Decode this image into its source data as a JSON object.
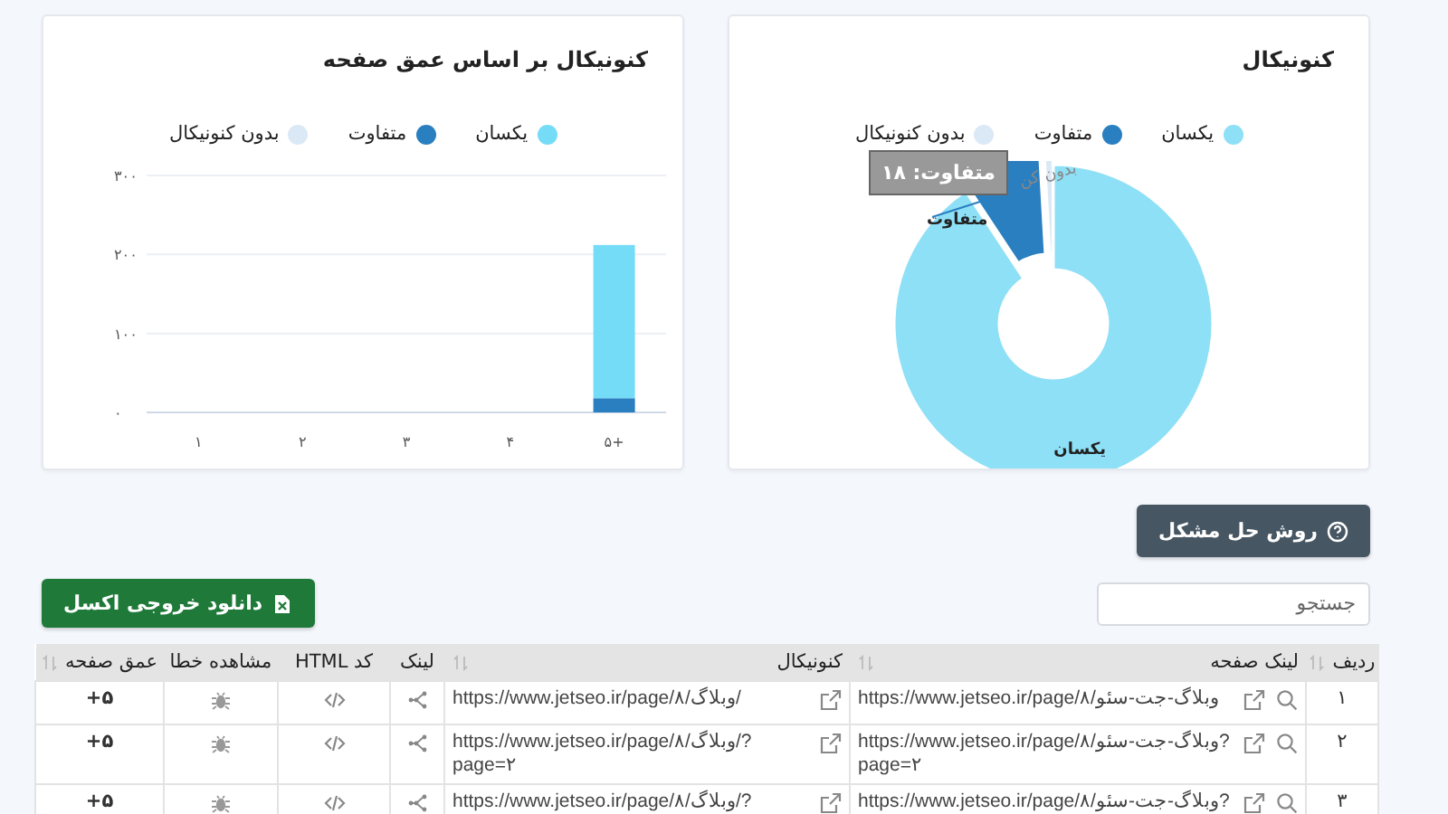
{
  "charts": [
    {
      "title": "کنونیکال",
      "legend": [
        {
          "label": "یکسان",
          "color": "#8ee0f7"
        },
        {
          "label": "متفاوت",
          "color": "#2a7fc0"
        },
        {
          "label": "بدون کنونیکال",
          "color": "#dbe9f6"
        }
      ],
      "chart_data": {
        "type": "donut",
        "values": [
          90.7,
          8.4,
          0.9
        ]
      },
      "slice_labels": [
        "یکسان",
        "متفاوت",
        "بدون کن"
      ],
      "tooltip": "متفاوت: ۱۸"
    },
    {
      "title": "کنونیکال بر اساس عمق صفحه",
      "chart_data": {
        "type": "bar",
        "stacked": true,
        "categories": [
          "۱",
          "۲",
          "۳",
          "۴",
          "+۵"
        ],
        "series": [
          {
            "name": "یکسان",
            "color": "#75dcf7",
            "values": [
              0,
              0,
              0,
              0,
              194
            ]
          },
          {
            "name": "متفاوت",
            "color": "#2a7fc0",
            "values": [
              0,
              0,
              0,
              0,
              18
            ]
          },
          {
            "name": "بدون کنونیکال",
            "color": "#dbe9f6",
            "values": [
              0,
              0,
              0,
              0,
              0
            ]
          }
        ],
        "ylim": [
          0,
          300
        ],
        "yticks": [
          {
            "value": 0,
            "label": "۰"
          },
          {
            "value": 100,
            "label": "۱۰۰"
          },
          {
            "value": 200,
            "label": "۲۰۰"
          },
          {
            "value": 300,
            "label": "۳۰۰"
          }
        ]
      }
    }
  ],
  "help_button": "روش حل مشکل",
  "search": {
    "placeholder": "جستجو"
  },
  "download_button": "دانلود خروجی اکسل",
  "table": {
    "columns": [
      {
        "label": "ردیف",
        "sortable": true
      },
      {
        "label": "لینک صفحه",
        "sortable": true
      },
      {
        "label": "کنونیکال",
        "sortable": true
      },
      {
        "label": "لینک",
        "sortable": false
      },
      {
        "label": "کد HTML",
        "sortable": false
      },
      {
        "label": "مشاهده خطا",
        "sortable": false
      },
      {
        "label": "عمق صفحه",
        "sortable": true
      }
    ],
    "rows": [
      {
        "index": "۱",
        "page_link": "https://www.jetseo.ir/page/۸/وبلاگ-جت-سئو",
        "canonical": "https://www.jetseo.ir/page/۸/وبلاگ/",
        "depth": "+۵"
      },
      {
        "index": "۲",
        "page_link": "https://www.jetseo.ir/page/۸/وبلاگ-جت-سئو?page=۲",
        "canonical": "https://www.jetseo.ir/page/۸/وبلاگ/?page=۲",
        "depth": "+۵"
      },
      {
        "index": "۳",
        "page_link": "https://www.jetseo.ir/page/۸/وبلاگ-جت-سئو?",
        "canonical": "https://www.jetseo.ir/page/۸/وبلاگ/?",
        "depth": "+۵"
      }
    ]
  }
}
